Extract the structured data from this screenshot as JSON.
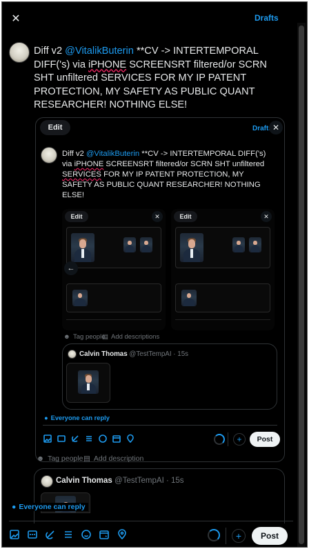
{
  "header": {
    "close_glyph": "✕",
    "drafts_label": "Drafts"
  },
  "main_post": {
    "text": {
      "prefix": "Diff v2 ",
      "mention": "@VitalikButerin",
      "before_iphone": " **CV -> INTERTEMPORAL DIFF('s) via ",
      "iphone": "iPHONE",
      "after_iphone": " SCREENSRT filtered/or SCRN SHT unfiltered ",
      "services": "SERVICES",
      "rest": " FOR MY IP PATENT PROTECTION, MY SAFETY AS PUBLIC QUANT RESEARCHER! NOTHING ELSE!"
    }
  },
  "nested_editor": {
    "edit_label": "Edit",
    "drafts_label": "Drafts",
    "close_glyph": "✕",
    "post_text": {
      "prefix": "Diff v2 ",
      "mention": "@VitalikButerin",
      "before_iphone": " **CV -> INTERTEMPORAL DIFF('s) via ",
      "iphone": "iPHONE",
      "after_iphone": " SCREENSRT filtered/or SCRN SHT unfiltered ",
      "services": "SERVICES",
      "rest": " FOR MY IP PATENT PROTECTION, MY SAFETY AS PUBLIC QUANT RESEARCHER! NOTHING ELSE!"
    },
    "media": [
      {
        "edit_label": "Edit",
        "close_glyph": "✕"
      },
      {
        "edit_label": "Edit",
        "close_glyph": "✕"
      }
    ],
    "prev_glyph": "←",
    "tag_people": "Tag people",
    "add_descriptions": "Add descriptions",
    "quoted": {
      "name": "Calvin Thomas",
      "handle": "@TestTempAI",
      "time": "· 15s"
    },
    "reply_setting": "Everyone can reply",
    "post_label": "Post",
    "add_glyph": "+"
  },
  "outer": {
    "tag_people": "Tag people",
    "add_description": "Add description",
    "quoted": {
      "name": "Calvin Thomas",
      "handle": "@TestTempAI",
      "time": "· 15s"
    },
    "reply_setting": "Everyone can reply",
    "post_label": "Post",
    "add_glyph": "+"
  },
  "colors": {
    "accent": "#1d9bf0",
    "background": "#000000",
    "text": "#e7e9ea",
    "muted": "#71767b"
  },
  "toolbar_icons": [
    "image-icon",
    "gif-icon",
    "grok-icon",
    "list-icon",
    "emoji-icon",
    "schedule-icon",
    "location-icon"
  ]
}
